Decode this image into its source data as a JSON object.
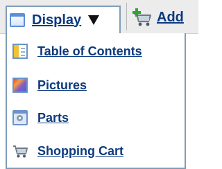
{
  "toolbar": {
    "display_label": "Display",
    "add_label": "Add"
  },
  "menu": {
    "items": [
      {
        "label": "Table of Contents",
        "icon": "table-of-contents-icon"
      },
      {
        "label": "Pictures",
        "icon": "pictures-icon"
      },
      {
        "label": "Parts",
        "icon": "parts-icon"
      },
      {
        "label": "Shopping Cart",
        "icon": "shopping-cart-icon"
      }
    ]
  },
  "colors": {
    "link": "#0c3a7e",
    "frame": "#7f9db9",
    "toolbar_bg": "#ececec"
  }
}
